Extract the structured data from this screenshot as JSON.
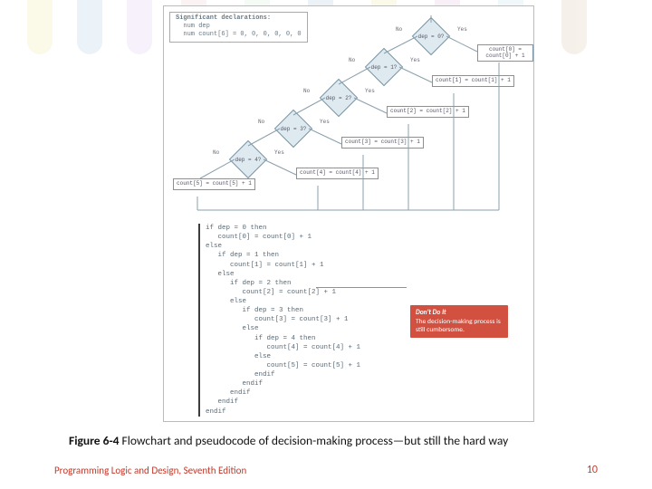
{
  "background_stripe_colors": [
    "#e9d96a",
    "#7daed6",
    "#c5a7e0",
    "#e7b1b1",
    "#b7e3b7",
    "#7daed6",
    "#e9d96a",
    "#d7a0c7",
    "#a3d6e6",
    "#c7a27c"
  ],
  "declarations": {
    "title": "Significant declarations:",
    "line1": "num dep",
    "line2": "num count[6] = 0, 0, 0, 0, 0, 0"
  },
  "decisions": {
    "d0": "dep = 0?",
    "d1": "dep = 1?",
    "d2": "dep = 2?",
    "d3": "dep = 3?",
    "d4": "dep = 4?"
  },
  "branch_labels": {
    "no": "No",
    "yes": "Yes"
  },
  "actions": {
    "a0": "count[0] =\ncount[0] + 1",
    "a1": "count[1] =\ncount[1] + 1",
    "a2": "count[2] =\ncount[2] + 1",
    "a3": "count[3] =\ncount[3] + 1",
    "a4": "count[4] =\ncount[4] + 1",
    "a5": "count[5] =\ncount[5] + 1"
  },
  "pseudocode": "if dep = 0 then\n   count[0] = count[0] + 1\nelse\n   if dep = 1 then\n      count[1] = count[1] + 1\n   else\n      if dep = 2 then\n         count[2] = count[2] + 1\n      else\n         if dep = 3 then\n            count[3] = count[3] + 1\n         else\n            if dep = 4 then\n               count[4] = count[4] + 1\n            else\n               count[5] = count[5] + 1\n            endif\n         endif\n      endif\n   endif\nendif",
  "callout": {
    "title": "Don't Do It",
    "body": "The decision-making process is still cumbersome."
  },
  "caption": {
    "label": "Figure 6-4",
    "text": " Flowchart and pseudocode of decision-making process—but still the hard way"
  },
  "footer": {
    "left": "Programming Logic and Design, Seventh Edition",
    "right": "10"
  }
}
